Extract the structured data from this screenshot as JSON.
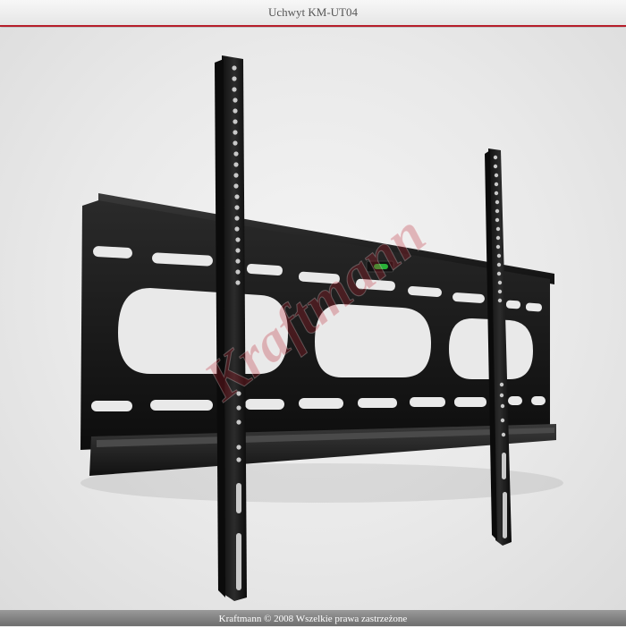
{
  "window": {
    "title": "Uchwyt KM-UT04"
  },
  "product_image": {
    "watermark": "Kraftmann",
    "accent_color": "#b61e2a",
    "level_color": "#2ecc40"
  },
  "footer": {
    "copyright": "Kraftmann © 2008 Wszelkie prawa zastrzeżone"
  }
}
